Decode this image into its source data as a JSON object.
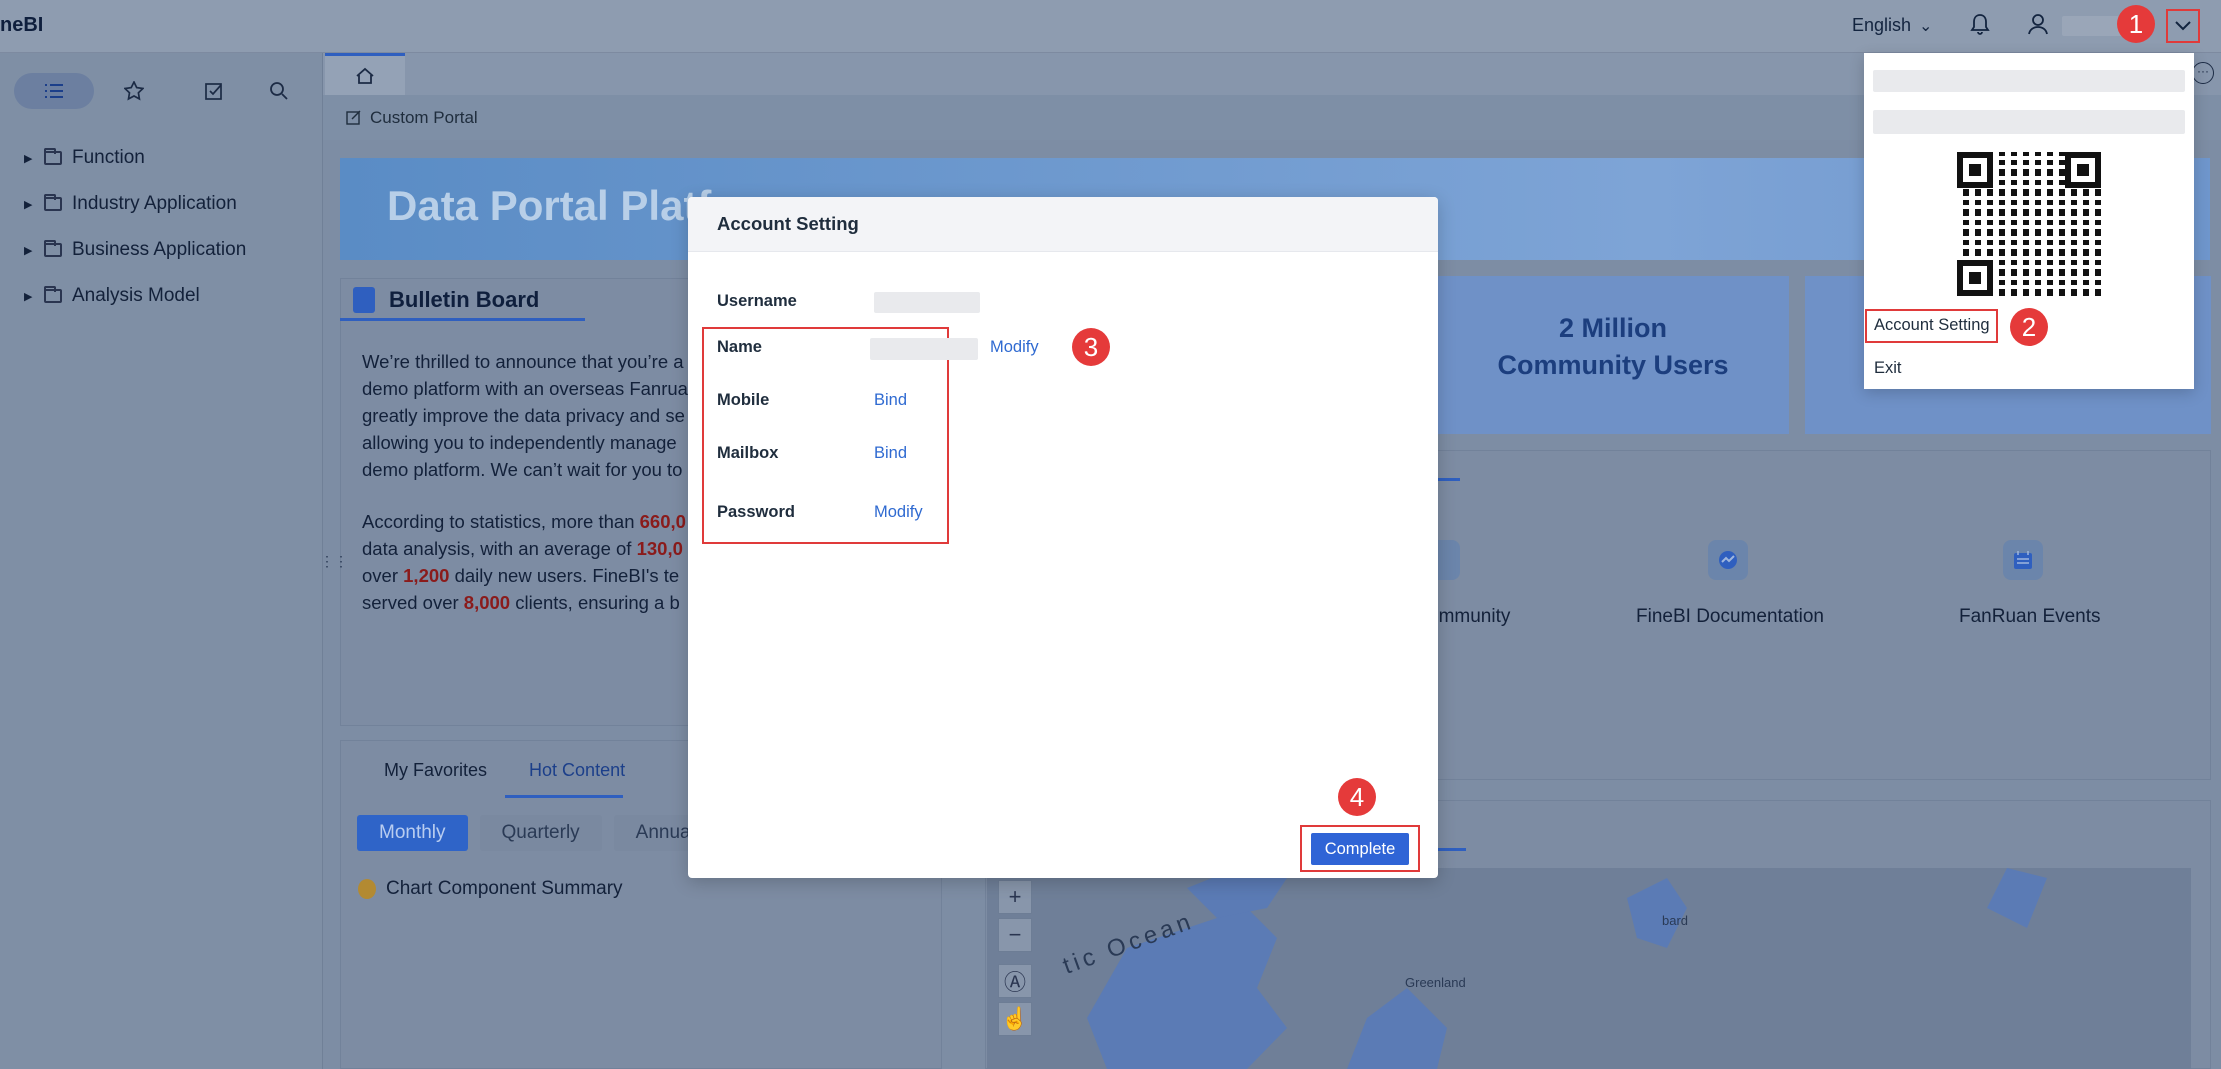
{
  "app": {
    "brand": "neBI"
  },
  "topbar": {
    "language": "English",
    "chevron": "⌵",
    "bell": "🔔",
    "user_icon": "👤",
    "dropdown_toggle": "⌵"
  },
  "sidebar": {
    "tabs": [
      "list-icon",
      "star-icon",
      "edit-icon",
      "search-icon"
    ],
    "items": [
      {
        "label": "Function"
      },
      {
        "label": "Industry Application"
      },
      {
        "label": "Business Application"
      },
      {
        "label": "Analysis Model"
      }
    ]
  },
  "tabs": {
    "home_icon": "⌂",
    "custom_portal": "Custom Portal"
  },
  "banner": {
    "title": "Data Portal Platf"
  },
  "bulletin": {
    "title": "Bulletin Board",
    "para1": "We’re thrilled to announce that you’re a\ndemo platform with an overseas Fanrua\ngreatly improve the data privacy and se\nallowing you to independently manage\ndemo platform. We can’t wait for you to",
    "para2_prefix": "According to statistics, more than ",
    "v1": "660,0",
    "para2_l2": "data analysis, with an average of ",
    "v2": "130,0",
    "para2_l3a": "over ",
    "v3": "1,200",
    "para2_l3b": " daily new users. FineBI's te",
    "para2_l4a": "served over ",
    "v4": "8,000",
    "para2_l4b": " clients, ensuring a b"
  },
  "stats": {
    "community": "2 Million\nCommunity Users"
  },
  "links": [
    {
      "label": "ommunity"
    },
    {
      "label": "FineBI Documentation"
    },
    {
      "label": "FanRuan Events"
    }
  ],
  "favorites": {
    "tabs": [
      "My Favorites",
      "Hot Content"
    ],
    "periods": [
      "Monthly",
      "Quarterly",
      "Annua"
    ],
    "summary": "Chart Component Summary"
  },
  "map": {
    "ocean_label": "tic Ocean",
    "greenland": "Greenland",
    "bard": "bard",
    "zoom_in": "+",
    "zoom_out": "−"
  },
  "modal": {
    "title": "Account Setting",
    "rows": [
      {
        "label": "Username",
        "action": ""
      },
      {
        "label": "Name",
        "action": "Modify"
      },
      {
        "label": "Mobile",
        "action": "Bind"
      },
      {
        "label": "Mailbox",
        "action": "Bind"
      },
      {
        "label": "Password",
        "action": "Modify"
      }
    ],
    "complete": "Complete"
  },
  "dropdown": {
    "account_setting": "Account Setting",
    "exit": "Exit"
  },
  "badges": [
    "1",
    "2",
    "3",
    "4"
  ],
  "colors": {
    "accent": "#2f64d6",
    "annotation_red": "#e53a3a"
  }
}
